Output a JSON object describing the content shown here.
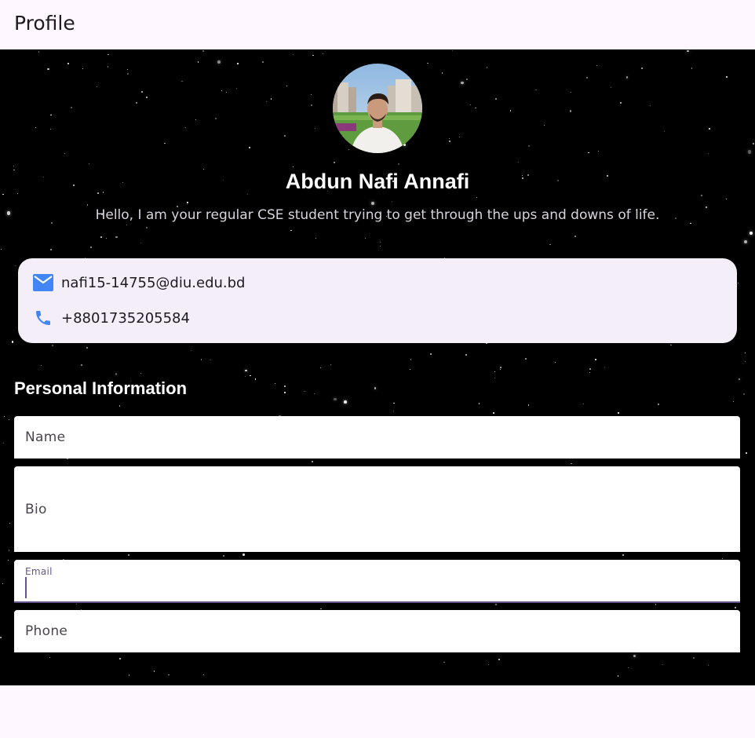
{
  "appbar": {
    "title": "Profile"
  },
  "profile": {
    "name": "Abdun Nafi Annafi",
    "bio": "Hello, I am your regular CSE student trying to get through the ups and downs of life."
  },
  "contact": {
    "email": "nafi15-14755@diu.edu.bd",
    "phone": "+8801735205584",
    "icon_color": "#4285f4"
  },
  "form": {
    "section_title": "Personal Information",
    "fields": [
      {
        "label": "Name",
        "value": ""
      },
      {
        "label": "Bio",
        "value": ""
      },
      {
        "label": "Email",
        "value": "",
        "focused": true
      },
      {
        "label": "Phone",
        "value": ""
      }
    ]
  },
  "colors": {
    "app_bg": "#fef7ff",
    "card_bg": "#f3eef7",
    "accent": "#65558f",
    "background": "#000000"
  }
}
